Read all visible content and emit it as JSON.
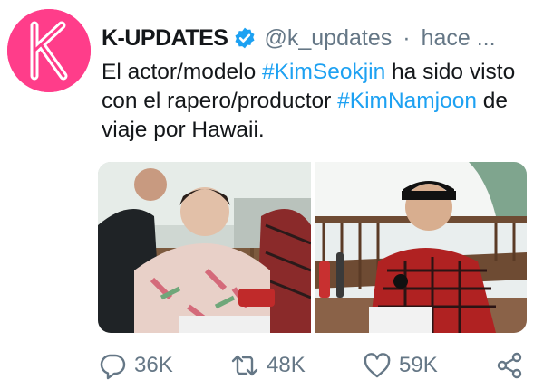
{
  "tweet": {
    "avatar_letter": "K",
    "display_name": "K-UPDATES",
    "handle": "@k_updates",
    "separator": "·",
    "time": "hace ...",
    "text_parts": {
      "t1": "El actor/modelo ",
      "h1": "#KimSeokjin",
      "t2": " ha sido visto con el rapero/productor ",
      "h2": "#KimNamjoon",
      "t3": " de viaje por Hawaii."
    },
    "images": [
      {
        "icon": "photo-icon"
      },
      {
        "icon": "photo-icon"
      }
    ]
  },
  "actions": {
    "reply_count": "36K",
    "retweet_count": "48K",
    "like_count": "59K"
  },
  "colors": {
    "avatar_bg": "#ff3d8a",
    "hashtag": "#1da1f2",
    "verified": "#1da1f2",
    "muted": "#657786",
    "text": "#14171a"
  },
  "icons": {
    "reply": "reply-icon",
    "retweet": "retweet-icon",
    "like": "heart-icon",
    "share": "share-icon",
    "verified": "verified-badge-icon"
  }
}
